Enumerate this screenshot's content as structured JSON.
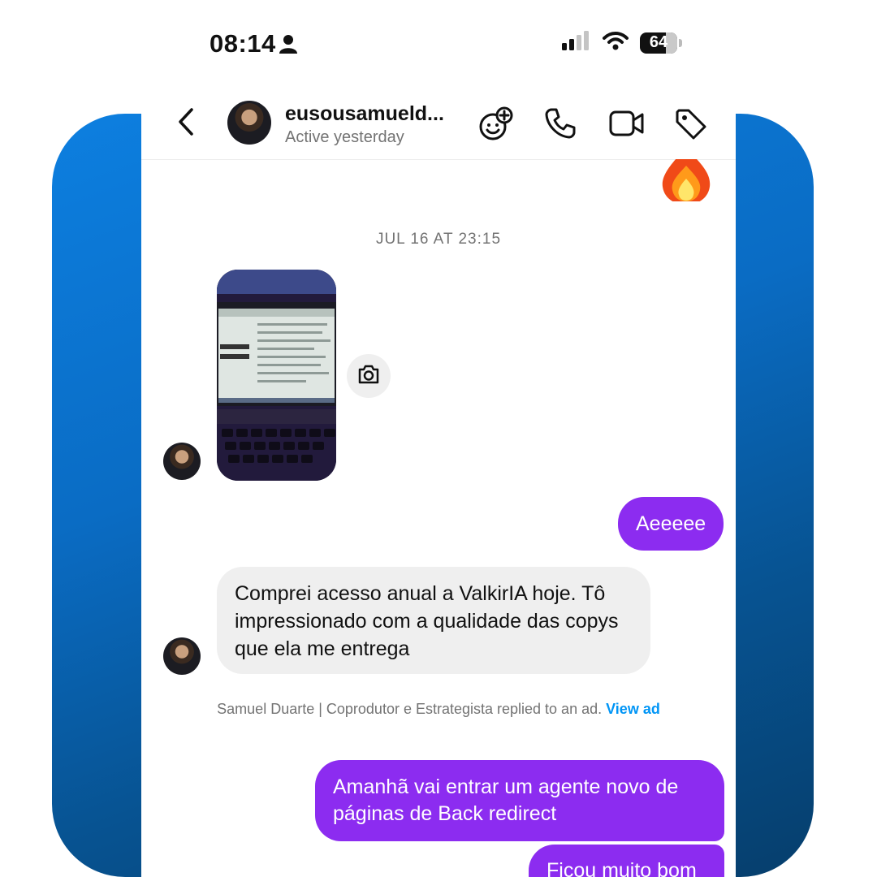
{
  "status_bar": {
    "time": "08:14",
    "battery": "64"
  },
  "header": {
    "name": "eusousamueld...",
    "status": "Active yesterday"
  },
  "chat": {
    "timestamp": "JUL 16 AT 23:15",
    "messages": [
      {
        "from": "me",
        "text": "Aeeeee"
      },
      {
        "from": "them",
        "text": "Comprei acesso anual a ValkirIA hoje. Tô impressionado com a qualidade das copys que ela me entrega"
      },
      {
        "from": "me",
        "text": "Amanhã vai entrar um agente novo de páginas de Back redirect"
      },
      {
        "from": "me",
        "text": "Ficou muito bom"
      }
    ],
    "ad_note": {
      "text": "Samuel Duarte | Coprodutor e Estrategista replied to an ad.",
      "link": "View ad"
    }
  },
  "colors": {
    "outgoing_bubble": "#8c2cf0",
    "incoming_bubble": "#efefef",
    "link": "#0095f6",
    "background_gradient": [
      "#0d7fe0",
      "#063e6c"
    ]
  },
  "icons": [
    "person-icon",
    "cellular-signal-icon",
    "wifi-icon",
    "battery-icon",
    "back-chevron-icon",
    "effects-add-icon",
    "phone-call-icon",
    "video-call-icon",
    "tag-icon",
    "fire-reaction-icon",
    "camera-icon"
  ]
}
